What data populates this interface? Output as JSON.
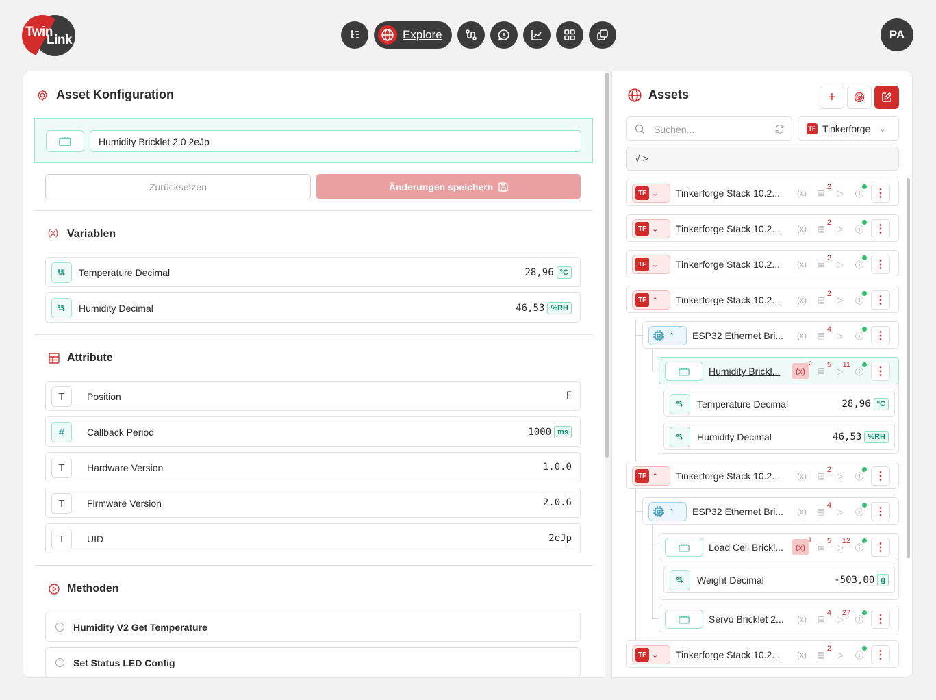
{
  "brand": {
    "line1": "Twin",
    "line2": "Link"
  },
  "nav": {
    "explore_label": "Explore"
  },
  "user": {
    "initials": "PA"
  },
  "colors": {
    "accent": "#d42b2b",
    "teal": "#9ce3d5",
    "dark": "#3b3b3b"
  },
  "left": {
    "title": "Asset Konfiguration",
    "asset_name": "Humidity Bricklet 2.0 2eJp",
    "reset_label": "Zurücksetzen",
    "save_label": "Änderungen speichern",
    "variables_title": "Variablen",
    "variables": [
      {
        "label": "Temperature Decimal",
        "value": "28,96",
        "unit": "°C"
      },
      {
        "label": "Humidity Decimal",
        "value": "46,53",
        "unit": "%RH"
      }
    ],
    "attributes_title": "Attribute",
    "attributes": [
      {
        "type": "T",
        "label": "Position",
        "value": "F",
        "unit": ""
      },
      {
        "type": "#",
        "label": "Callback Period",
        "value": "1000",
        "unit": "ms"
      },
      {
        "type": "T",
        "label": "Hardware Version",
        "value": "1.0.0",
        "unit": ""
      },
      {
        "type": "T",
        "label": "Firmware Version",
        "value": "2.0.6",
        "unit": ""
      },
      {
        "type": "T",
        "label": "UID",
        "value": "2eJp",
        "unit": ""
      }
    ],
    "methods_title": "Methoden",
    "methods": [
      {
        "label": "Humidity V2 Get Temperature"
      },
      {
        "label": "Set Status LED Config"
      }
    ]
  },
  "right": {
    "title": "Assets",
    "search_placeholder": "Suchen...",
    "filter_label": "Tinkerforge",
    "breadcrumb": "√  >",
    "tree": {
      "stack_label": "Tinkerforge Stack 10.2...",
      "esp_label": "ESP32 Ethernet Bri...",
      "humidity_label": "Humidity Brickl...",
      "loadcell_label": "Load Cell Brickl...",
      "servo_label": "Servo Bricklet 2...",
      "stack_count": "2",
      "esp_count": "4",
      "hum_vars": "2",
      "hum_attrs": "5",
      "hum_methods": "11",
      "lc_vars": "1",
      "lc_attrs": "5",
      "lc_methods": "12",
      "servo_attrs": "4",
      "servo_methods": "27",
      "hum_var1_label": "Temperature Decimal",
      "hum_var1_value": "28,96",
      "hum_var1_unit": "°C",
      "hum_var2_label": "Humidity Decimal",
      "hum_var2_value": "46,53",
      "hum_var2_unit": "%RH",
      "lc_var_label": "Weight Decimal",
      "lc_var_value": "-503,00",
      "lc_var_unit": "g"
    }
  }
}
